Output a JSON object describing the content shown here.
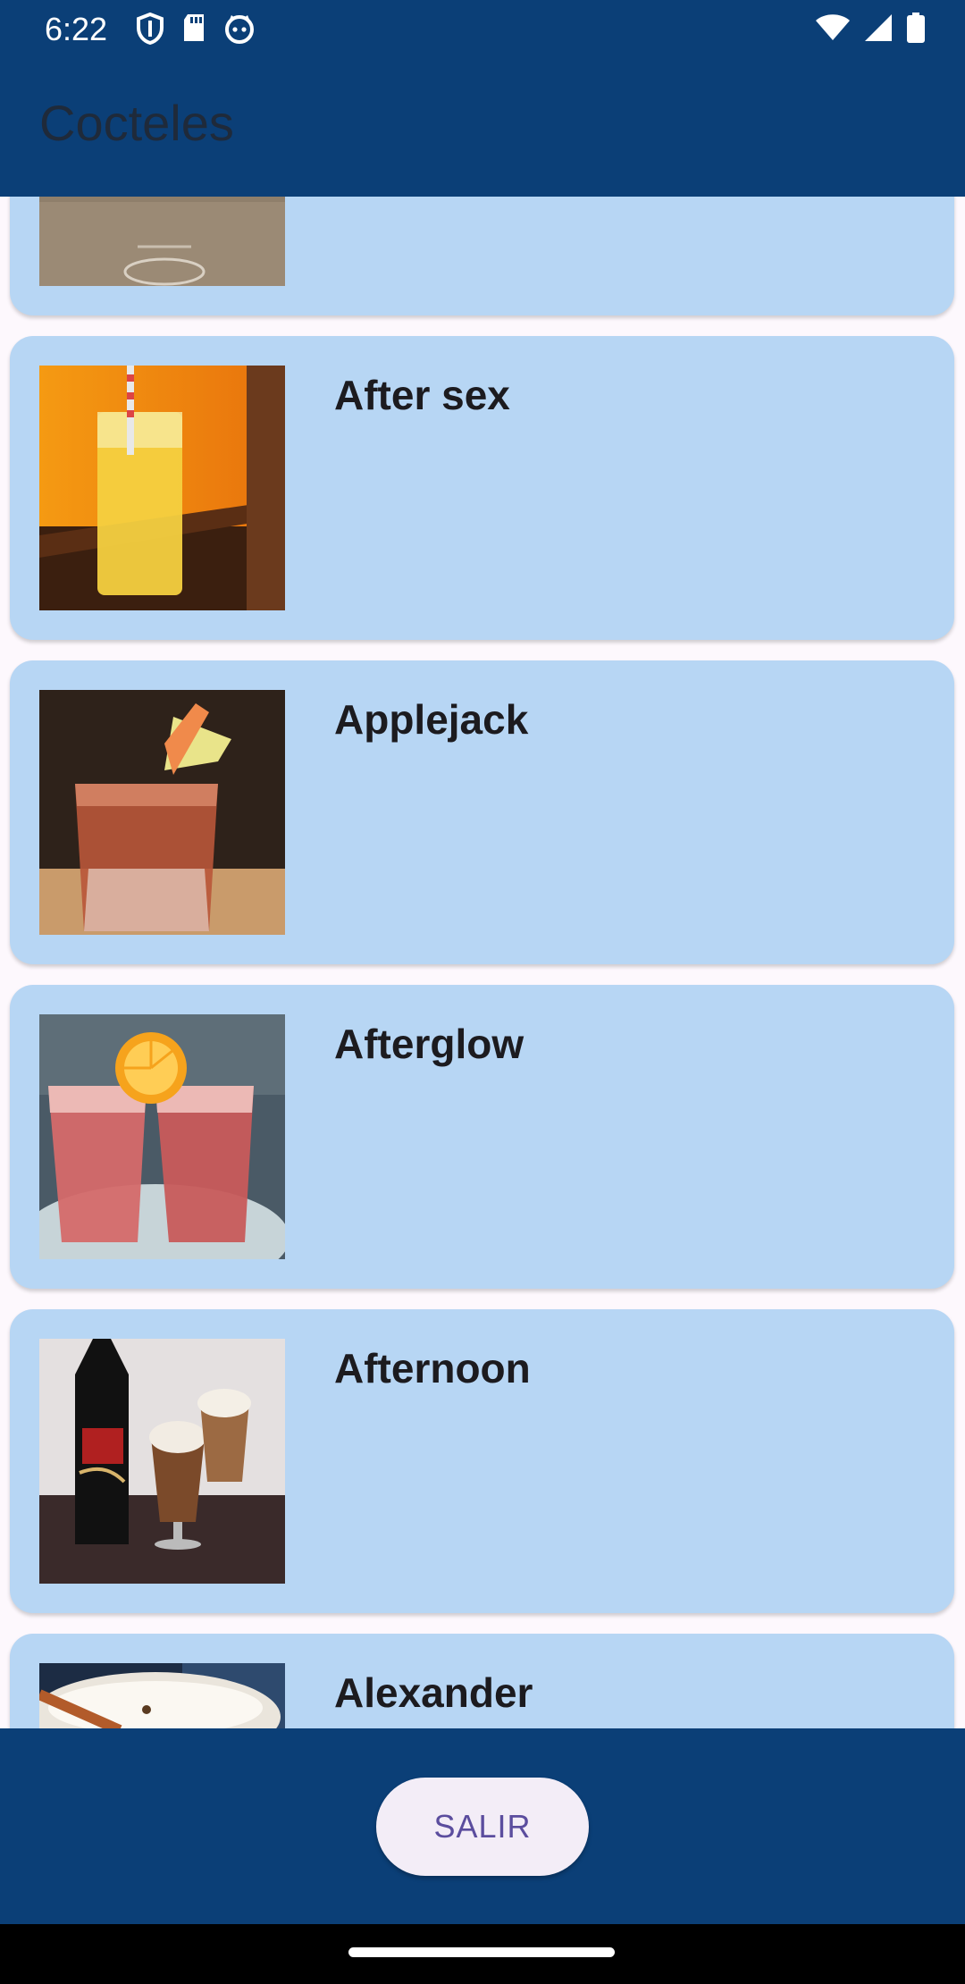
{
  "status_bar": {
    "time": "6:22",
    "left_icons": [
      "shield-icon",
      "sd-card-icon",
      "cat-face-icon"
    ],
    "right_icons": [
      "wifi-icon",
      "cell-signal-icon",
      "battery-icon"
    ]
  },
  "app_bar": {
    "title": "Cocteles"
  },
  "cocktails": [
    {
      "name": "",
      "image": "cocktail-photo-partial"
    },
    {
      "name": "After sex",
      "image": "orange-highball-photo"
    },
    {
      "name": "Applejack",
      "image": "lowball-garnish-photo"
    },
    {
      "name": "Afterglow",
      "image": "two-pink-drinks-photo"
    },
    {
      "name": "Afternoon",
      "image": "baileys-coffee-photo"
    },
    {
      "name": "Alexander",
      "image": "creamy-cocktail-photo"
    }
  ],
  "bottom_bar": {
    "exit_label": "SALIR"
  },
  "colors": {
    "app_bar": "#0b3f77",
    "card": "#b7d6f4",
    "background": "#fdf8fd",
    "button_bg": "#f3edf7",
    "button_text": "#5b4d9e"
  }
}
